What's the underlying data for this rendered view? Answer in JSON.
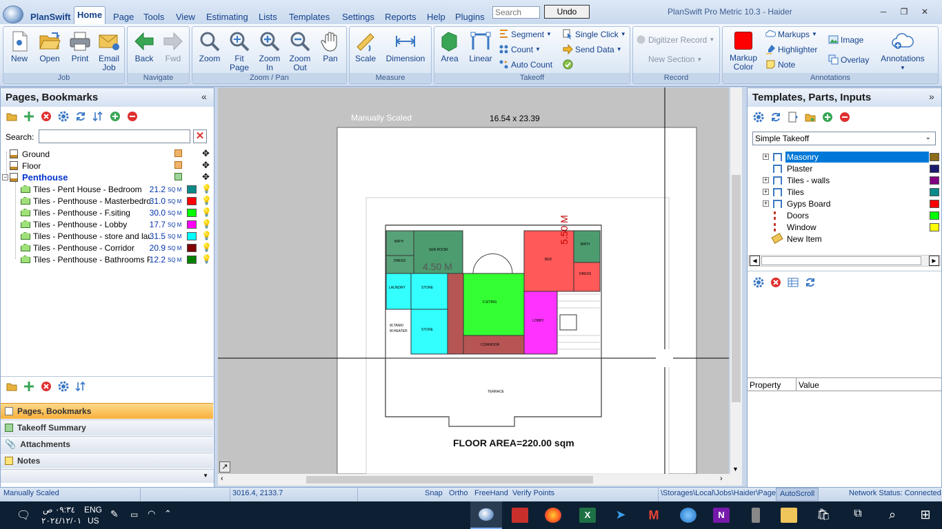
{
  "app": {
    "menu_name": "PlanSwift",
    "title": "PlanSwift Pro Metric 10.3 - Haider"
  },
  "menu": [
    "Home",
    "Page",
    "Tools",
    "View",
    "Estimating",
    "Lists",
    "Templates",
    "Settings",
    "Reports",
    "Help",
    "Plugins"
  ],
  "search": {
    "placeholder": "Search"
  },
  "undo_label": "Undo",
  "ribbon": {
    "job": {
      "label": "Job",
      "buttons": [
        "New",
        "Open",
        "Print",
        "Email\nJob"
      ]
    },
    "navigate": {
      "label": "Navigate",
      "buttons": [
        "Back",
        "Fwd"
      ]
    },
    "zoom": {
      "label": "Zoom / Pan",
      "buttons": [
        "Zoom",
        "Fit\nPage",
        "Zoom\nIn",
        "Zoom\nOut",
        "Pan"
      ]
    },
    "measure": {
      "label": "Measure",
      "buttons": [
        "Scale",
        "Dimension"
      ]
    },
    "takeoff": {
      "label": "Takeoff",
      "buttons": [
        "Area",
        "Linear"
      ],
      "small": [
        "Segment",
        "Count",
        "Auto Count",
        "Single Click",
        "Send Data"
      ]
    },
    "record": {
      "label": "Record",
      "small": [
        "Digitizer Record",
        "New Section"
      ]
    },
    "annotations": {
      "label": "Annotations",
      "markup_color": "Markup\nColor",
      "small": [
        "Markups",
        "Highlighter",
        "Note",
        "Image",
        "Overlay"
      ],
      "annotations_btn": "Annotations"
    }
  },
  "left_panel": {
    "title": "Pages, Bookmarks",
    "search_label": "Search:",
    "pages": [
      {
        "name": "Ground"
      },
      {
        "name": "Floor"
      },
      {
        "name": "Penthouse"
      }
    ],
    "items": [
      {
        "name": "Tiles - Pent House - Bedroom",
        "qty": "21.2",
        "unit": "SQ M",
        "color": "#0b8a8a"
      },
      {
        "name": "Tiles - Penthouse - Masterbedroom",
        "qty": "31.0",
        "unit": "SQ M",
        "color": "#ff0000"
      },
      {
        "name": "Tiles - Penthouse - F.siting",
        "qty": "30.0",
        "unit": "SQ M",
        "color": "#00ff00"
      },
      {
        "name": "Tiles - Penthouse - Lobby",
        "qty": "17.7",
        "unit": "SQ M",
        "color": "#ff00ff"
      },
      {
        "name": "Tiles - Penthouse - store and lau...",
        "qty": "31.5",
        "unit": "SQ M",
        "color": "#00ffff"
      },
      {
        "name": "Tiles - Penthouse - Corridor",
        "qty": "20.9",
        "unit": "SQ M",
        "color": "#800000"
      },
      {
        "name": "Tiles - Penthouse -  Bathrooms F...",
        "qty": "12.2",
        "unit": "SQ M",
        "color": "#008000"
      }
    ],
    "nav_tabs": [
      "Pages, Bookmarks",
      "Takeoff Summary",
      "Attachments",
      "Notes"
    ]
  },
  "canvas": {
    "scale_text": "Manually Scaled",
    "page_size": "16.54 x 23.39",
    "labels": {
      "area_1": "4.50 M",
      "area_2": "5.50 M",
      "floor_area": "FLOOR  AREA=220.00 sqm",
      "terrace": "TERRACE",
      "bath_1": "BATH",
      "ser_room": "SER.ROOM",
      "dress": "DRESS",
      "laundry": "LAUNDRY",
      "store_1": "STORE",
      "store_2": "STORE",
      "wtank": "W.TANK/\nW.HEATER",
      "fsiting": "F.SITING",
      "corridor": "CORRIDOR",
      "bed": "BED",
      "bath_2": "BATH",
      "dress_2": "DRESS",
      "lobby": "LOBBY"
    }
  },
  "right_panel": {
    "title": "Templates, Parts, Inputs",
    "dropdown": "Simple Takeoff",
    "items": [
      {
        "name": "Masonry",
        "color": "#8b6d1b",
        "expand": "+"
      },
      {
        "name": "Plaster",
        "color": "#1a1a6e",
        "expand": ""
      },
      {
        "name": "Tiles - walls",
        "color": "#800080",
        "expand": "+"
      },
      {
        "name": "Tiles",
        "color": "#0b8a8a",
        "expand": "+"
      },
      {
        "name": "Gyps Board",
        "color": "#ff0000",
        "expand": "+"
      },
      {
        "name": "Doors",
        "color": "#00ff00",
        "expand": ""
      },
      {
        "name": "Window",
        "color": "#ffff00",
        "expand": ""
      },
      {
        "name": "New Item",
        "color": "",
        "expand": ""
      }
    ],
    "prop_headers": [
      "Property",
      "Value"
    ]
  },
  "statusbar": {
    "scale": "Manually Scaled",
    "coords": "3016.4, 2133.7",
    "toggles": [
      "Snap",
      "Ortho",
      "FreeHand",
      "Verify Points"
    ],
    "path": "\\Storages\\Local\\Jobs\\Haider\\Page",
    "autoscroll": "AutoScroll",
    "network": "Network Status: Connected"
  },
  "taskbar": {
    "time": "٠٩:٣٤ ص",
    "date": "٢٠٢٤/١٢/٠١",
    "lang_1": "ENG",
    "lang_2": "US"
  }
}
